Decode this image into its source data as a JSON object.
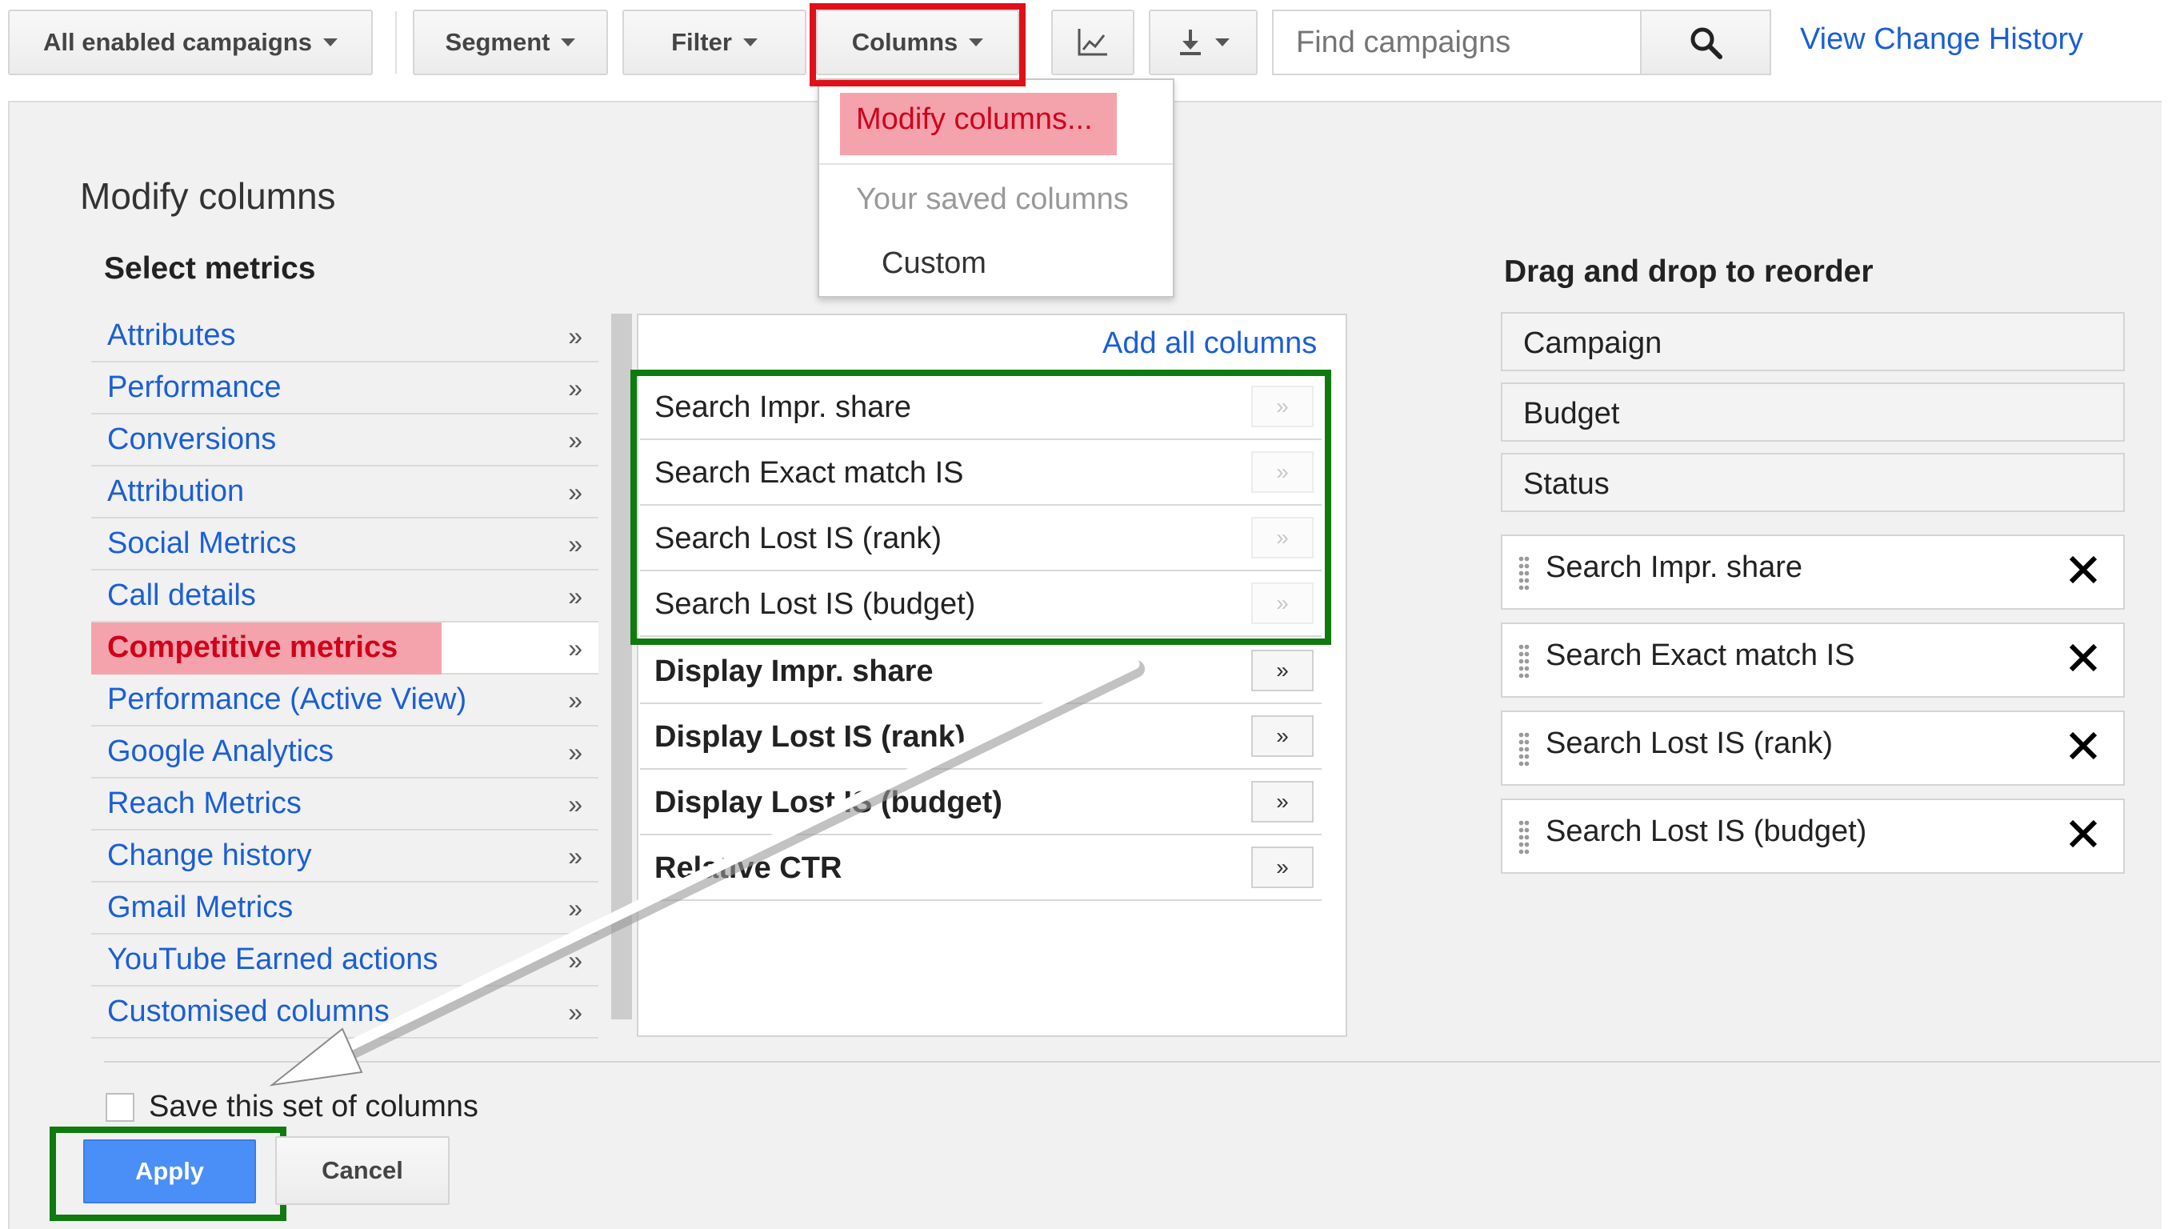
{
  "toolbar": {
    "campaigns_filter": "All enabled campaigns",
    "segment": "Segment",
    "filter": "Filter",
    "columns": "Columns",
    "search_placeholder": "Find campaigns",
    "view_change_history": "View Change History"
  },
  "columns_menu": {
    "modify": "Modify columns...",
    "saved_header": "Your saved columns",
    "custom": "Custom"
  },
  "modify_panel": {
    "title": "Modify columns",
    "select_metrics": "Select metrics",
    "add_all": "Add all columns",
    "drag_reorder": "Drag and drop to reorder",
    "categories": [
      {
        "label": "Attributes"
      },
      {
        "label": "Performance"
      },
      {
        "label": "Conversions"
      },
      {
        "label": "Attribution"
      },
      {
        "label": "Social Metrics"
      },
      {
        "label": "Call details"
      },
      {
        "label": "Competitive metrics"
      },
      {
        "label": "Performance (Active View)"
      },
      {
        "label": "Google Analytics"
      },
      {
        "label": "Reach Metrics"
      },
      {
        "label": "Change history"
      },
      {
        "label": "Gmail Metrics"
      },
      {
        "label": "YouTube Earned actions"
      },
      {
        "label": "Customised columns"
      }
    ],
    "active_category": "Competitive metrics",
    "metrics": [
      {
        "label": "Search Impr. share"
      },
      {
        "label": "Search Exact match IS"
      },
      {
        "label": "Search Lost IS (rank)"
      },
      {
        "label": "Search Lost IS (budget)"
      },
      {
        "label": "Display Impr. share"
      },
      {
        "label": "Display Lost IS (rank)"
      },
      {
        "label": "Display Lost IS (budget)"
      },
      {
        "label": "Relative CTR"
      }
    ],
    "fixed_columns": [
      {
        "label": "Campaign"
      },
      {
        "label": "Budget"
      },
      {
        "label": "Status"
      }
    ],
    "selected_columns": [
      {
        "label": "Search Impr. share"
      },
      {
        "label": "Search Exact match IS"
      },
      {
        "label": "Search Lost IS (rank)"
      },
      {
        "label": "Search Lost IS (budget)"
      }
    ],
    "save_set": "Save this set of columns",
    "apply": "Apply",
    "cancel": "Cancel"
  },
  "colors": {
    "link": "#1a5fd6",
    "highlight_red": "#f4a3ad",
    "annotation_green": "#0f7a0f",
    "annotation_red": "#e0101a",
    "apply_blue": "#4a8ff7"
  },
  "icons": [
    "caret-down-icon",
    "chart-icon",
    "download-icon",
    "search-icon",
    "double-chevron-right-icon",
    "drag-handle-icon",
    "close-icon"
  ]
}
